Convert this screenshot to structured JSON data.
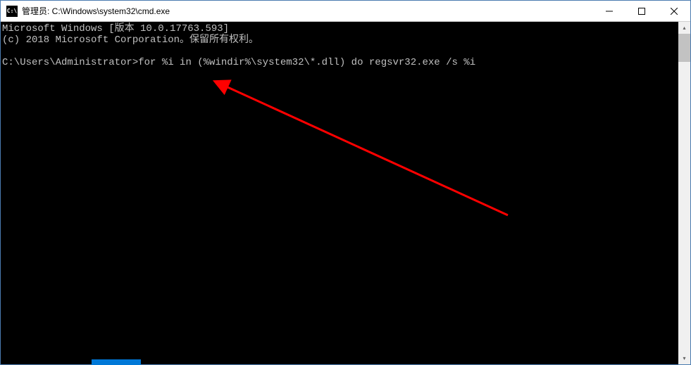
{
  "titlebar": {
    "icon_label": "C:\\",
    "text": "管理员: C:\\Windows\\system32\\cmd.exe"
  },
  "terminal": {
    "line1": "Microsoft Windows [版本 10.0.17763.593]",
    "line2": "(c) 2018 Microsoft Corporation。保留所有权利。",
    "line3": "",
    "prompt": "C:\\Users\\Administrator>",
    "command": "for %i in (%windir%\\system32\\*.dll) do regsvr32.exe /s %i"
  },
  "controls": {
    "minimize": "─",
    "maximize": "☐",
    "close": "✕"
  }
}
